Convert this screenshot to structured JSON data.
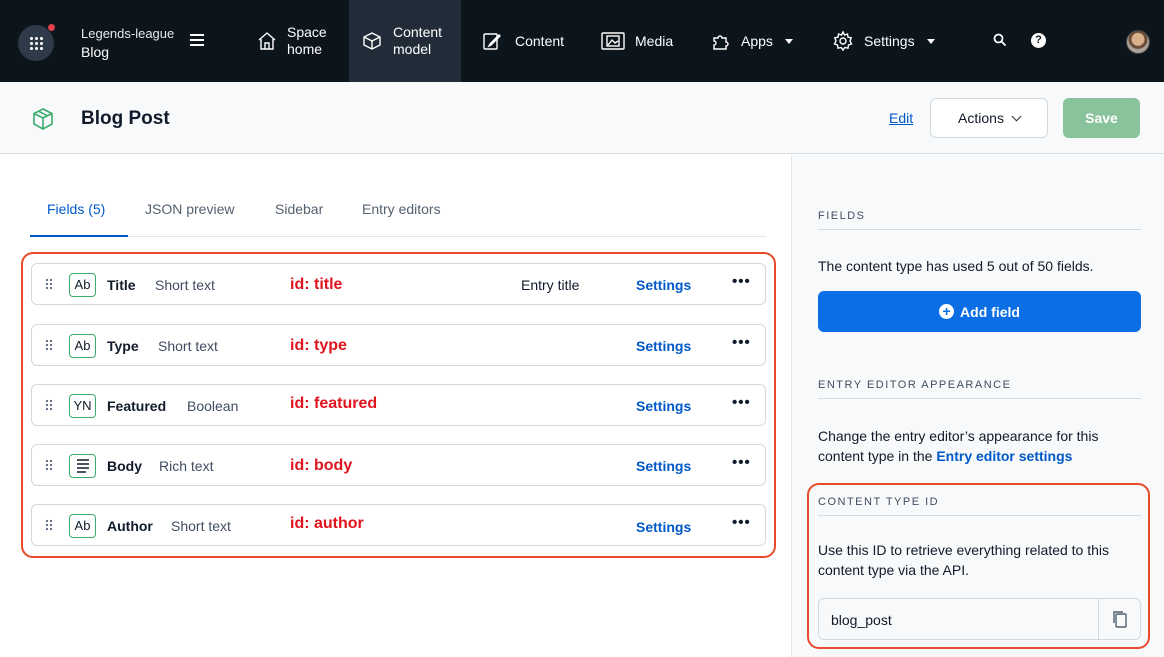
{
  "topbar": {
    "space_org": "Legends-league",
    "space_env": "Blog",
    "nav": {
      "space_home": [
        "Space",
        "home"
      ],
      "content_model": [
        "Content",
        "model"
      ],
      "content": "Content",
      "media": "Media",
      "apps": "Apps",
      "settings": "Settings"
    }
  },
  "header": {
    "title": "Blog Post",
    "edit_label": "Edit",
    "actions_label": "Actions",
    "save_label": "Save"
  },
  "tabs": [
    {
      "label": "Fields (5)",
      "active": true
    },
    {
      "label": "JSON preview",
      "active": false
    },
    {
      "label": "Sidebar",
      "active": false
    },
    {
      "label": "Entry editors",
      "active": false
    }
  ],
  "fields": [
    {
      "icon": "short-text-icon",
      "icon_text": "Ab",
      "name": "Title",
      "type": "Short text",
      "id_label": "id: title",
      "extra": "Entry title",
      "settings": "Settings",
      "more": "•••"
    },
    {
      "icon": "short-text-icon",
      "icon_text": "Ab",
      "name": "Type",
      "type": "Short text",
      "id_label": "id: type",
      "extra": "",
      "settings": "Settings",
      "more": "•••"
    },
    {
      "icon": "boolean-icon",
      "icon_text": "YN",
      "name": "Featured",
      "type": "Boolean",
      "id_label": "id: featured",
      "extra": "",
      "settings": "Settings",
      "more": "•••"
    },
    {
      "icon": "rich-text-icon",
      "icon_text": "",
      "name": "Body",
      "type": "Rich text",
      "id_label": "id: body",
      "extra": "",
      "settings": "Settings",
      "more": "•••"
    },
    {
      "icon": "short-text-icon",
      "icon_text": "Ab",
      "name": "Author",
      "type": "Short text",
      "id_label": "id: author",
      "extra": "",
      "settings": "Settings",
      "more": "•••"
    }
  ],
  "sidebar": {
    "fields_heading": "FIELDS",
    "fields_text": "The content type has used 5 out of 50 fields.",
    "add_field_label": "Add field",
    "appearance_heading": "ENTRY EDITOR APPEARANCE",
    "appearance_text": "Change the entry editor’s appearance for this content type in the",
    "appearance_link": "Entry editor settings",
    "ctid_heading": "CONTENT TYPE ID",
    "ctid_text": "Use this ID to retrieve everything related to this content type via the API.",
    "ctid_value": "blog_post"
  },
  "colors": {
    "topbar_bg": "#0c141c",
    "primary_blue": "#0059c8",
    "save_green": "#89c39b",
    "annotation_red": "#e94a2b",
    "id_label_red": "#e0141e",
    "field_icon_green": "#3bab6d"
  }
}
